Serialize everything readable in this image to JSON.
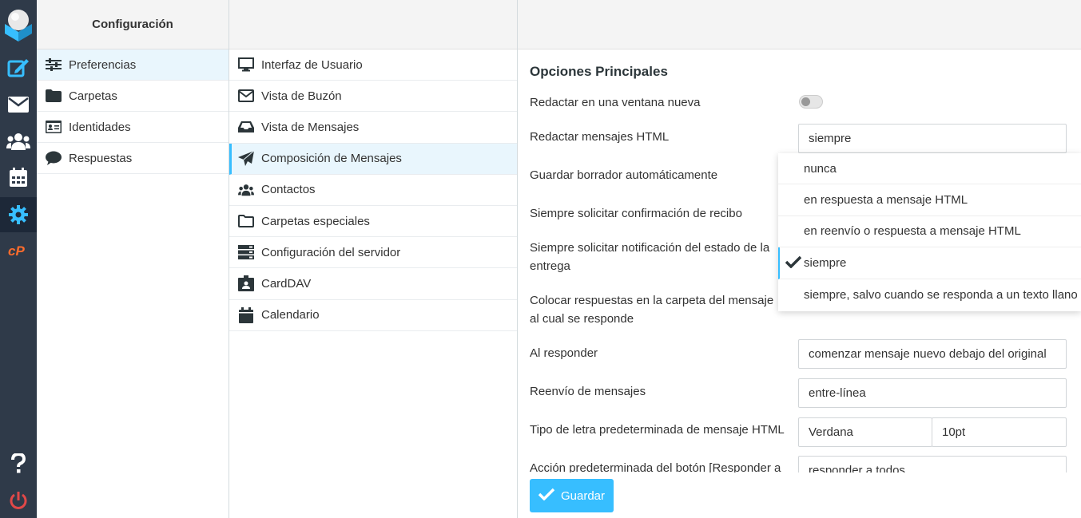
{
  "colors": {
    "accent": "#37beff",
    "rail": "#2f3a49",
    "logout": "#e04848"
  },
  "rail": {
    "logo": "roundcube-logo",
    "items": [
      {
        "icon": "compose-icon"
      },
      {
        "icon": "mail-icon"
      },
      {
        "icon": "contacts-icon"
      },
      {
        "icon": "calendar-icon"
      },
      {
        "icon": "settings-icon"
      },
      {
        "icon": "cpanel-icon"
      },
      {
        "icon": "help-icon"
      },
      {
        "icon": "logout-icon"
      }
    ]
  },
  "sections": {
    "title": "Configuración",
    "items": [
      {
        "label": "Preferencias",
        "icon": "sliders-icon"
      },
      {
        "label": "Carpetas",
        "icon": "folder-icon"
      },
      {
        "label": "Identidades",
        "icon": "id-card-icon"
      },
      {
        "label": "Respuestas",
        "icon": "comment-icon"
      }
    ]
  },
  "preferences": {
    "items": [
      {
        "label": "Interfaz de Usuario",
        "icon": "monitor-icon"
      },
      {
        "label": "Vista de Buzón",
        "icon": "envelope-icon"
      },
      {
        "label": "Vista de Mensajes",
        "icon": "inbox-icon"
      },
      {
        "label": "Composición de Mensajes",
        "icon": "paper-plane-icon"
      },
      {
        "label": "Contactos",
        "icon": "users-icon"
      },
      {
        "label": "Carpetas especiales",
        "icon": "folder-outline-icon"
      },
      {
        "label": "Configuración del servidor",
        "icon": "server-icon"
      },
      {
        "label": "CardDAV",
        "icon": "badge-icon"
      },
      {
        "label": "Calendario",
        "icon": "calendar-icon"
      }
    ]
  },
  "form": {
    "heading": "Opciones Principales",
    "rows": {
      "compose_new_window": "Redactar en una ventana nueva",
      "compose_html": "Redactar mensajes HTML",
      "autosave": "Guardar borrador automáticamente",
      "read_receipt": "Siempre solicitar confirmación de recibo",
      "delivery_status": "Siempre solicitar notificación del estado de la entrega",
      "reply_same_folder": "Colocar respuestas en la carpeta del mensaje al cual se responde",
      "reply_mode": "Al responder",
      "forward_mode": "Reenvío de mensajes",
      "default_font": "Tipo de letra predeterminada de mensaje HTML",
      "reply_all": "Acción predeterminada del botón [Responder a"
    },
    "values": {
      "compose_html": "siempre",
      "reply_mode": "comenzar mensaje nuevo debajo del original",
      "forward_mode": "entre-línea",
      "font_family": "Verdana",
      "font_size": "10pt",
      "reply_all": "responder a todos"
    }
  },
  "dropdown": {
    "options": [
      "nunca",
      "en respuesta a mensaje HTML",
      "en reenvío o respuesta a mensaje HTML",
      "siempre",
      "siempre, salvo cuando se responda a un texto llano"
    ],
    "selected_index": 3
  },
  "save_label": "Guardar"
}
